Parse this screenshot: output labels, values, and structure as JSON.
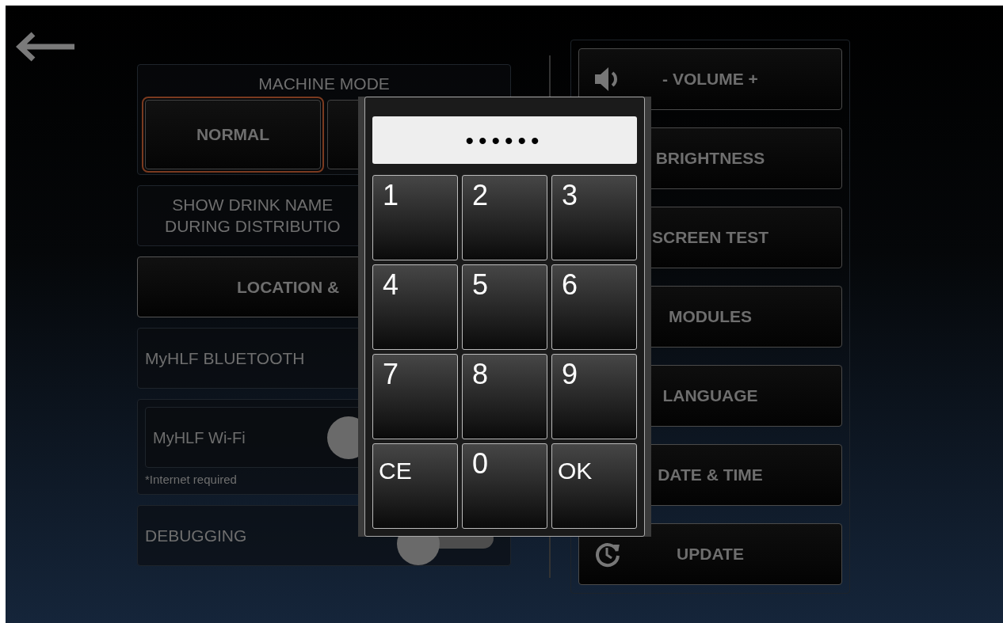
{
  "machine_mode": {
    "title": "MACHINE MODE",
    "options": [
      {
        "label": "NORMAL",
        "selected": true
      },
      {
        "selected": false
      }
    ]
  },
  "left_items": [
    {
      "kind": "text",
      "lines": [
        "SHOW DRINK NAME",
        "DURING DISTRIBUTIO"
      ]
    },
    {
      "kind": "button",
      "label": "LOCATION &"
    },
    {
      "kind": "toggle",
      "label": "MyHLF BLUETOOTH"
    },
    {
      "kind": "toggle_note",
      "label": "MyHLF Wi-Fi",
      "on": false,
      "note": "*Internet required"
    },
    {
      "kind": "toggle",
      "label": "DEBUGGING",
      "on": false
    }
  ],
  "right_buttons": [
    {
      "kind": "volume",
      "label": "- VOLUME +"
    },
    {
      "kind": "plain",
      "label": "BRIGHTNESS"
    },
    {
      "kind": "plain",
      "label": "SCREEN TEST"
    },
    {
      "kind": "plain",
      "label": "MODULES"
    },
    {
      "kind": "plain",
      "label": "LANGUAGE"
    },
    {
      "kind": "plain",
      "label": "DATE & TIME"
    },
    {
      "kind": "update",
      "label": "UPDATE"
    }
  ],
  "keypad": {
    "display": "••••••",
    "keys": [
      "1",
      "2",
      "3",
      "4",
      "5",
      "6",
      "7",
      "8",
      "9",
      "CE",
      "0",
      "OK"
    ]
  }
}
